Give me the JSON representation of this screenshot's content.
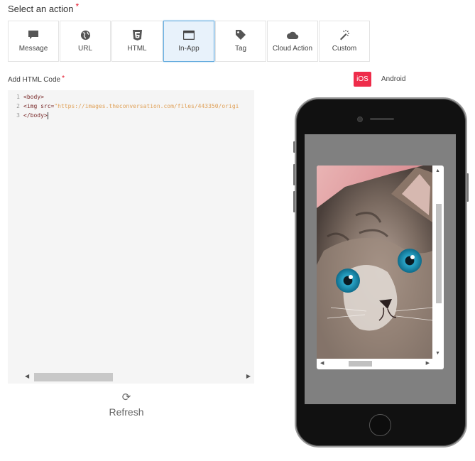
{
  "action_section": {
    "title": "Select an action",
    "required_mark": "*",
    "actions": [
      {
        "label": "Message",
        "icon": "chat-bubble-icon"
      },
      {
        "label": "URL",
        "icon": "globe-icon"
      },
      {
        "label": "HTML",
        "icon": "html5-icon"
      },
      {
        "label": "In-App",
        "icon": "window-icon"
      },
      {
        "label": "Tag",
        "icon": "tag-icon"
      },
      {
        "label": "Cloud Action",
        "icon": "cloud-icon"
      },
      {
        "label": "Custom",
        "icon": "magic-wand-icon"
      }
    ],
    "selected": "In-App"
  },
  "editor": {
    "label": "Add HTML Code",
    "required_mark": "*",
    "lines": [
      {
        "num": "1",
        "text": "<body>"
      },
      {
        "num": "2",
        "text": "<img src=\"https://images.theconversation.com/files/443350/origi"
      },
      {
        "num": "3",
        "text": "</body>"
      }
    ],
    "line2_tag": "<img ",
    "line2_attr": "src=",
    "line2_value": "\"https://images.theconversation.com/files/443350/origi"
  },
  "refresh": {
    "label": "Refresh",
    "icon": "refresh-icon"
  },
  "preview": {
    "platforms": [
      "iOS",
      "Android"
    ],
    "selected_platform": "iOS",
    "content_image": "kitten-photo"
  },
  "colors": {
    "accent_red": "#ee2c4a",
    "active_border": "#5fa8dd",
    "active_bg": "#e8f2fb",
    "screen_overlay": "#808080"
  }
}
